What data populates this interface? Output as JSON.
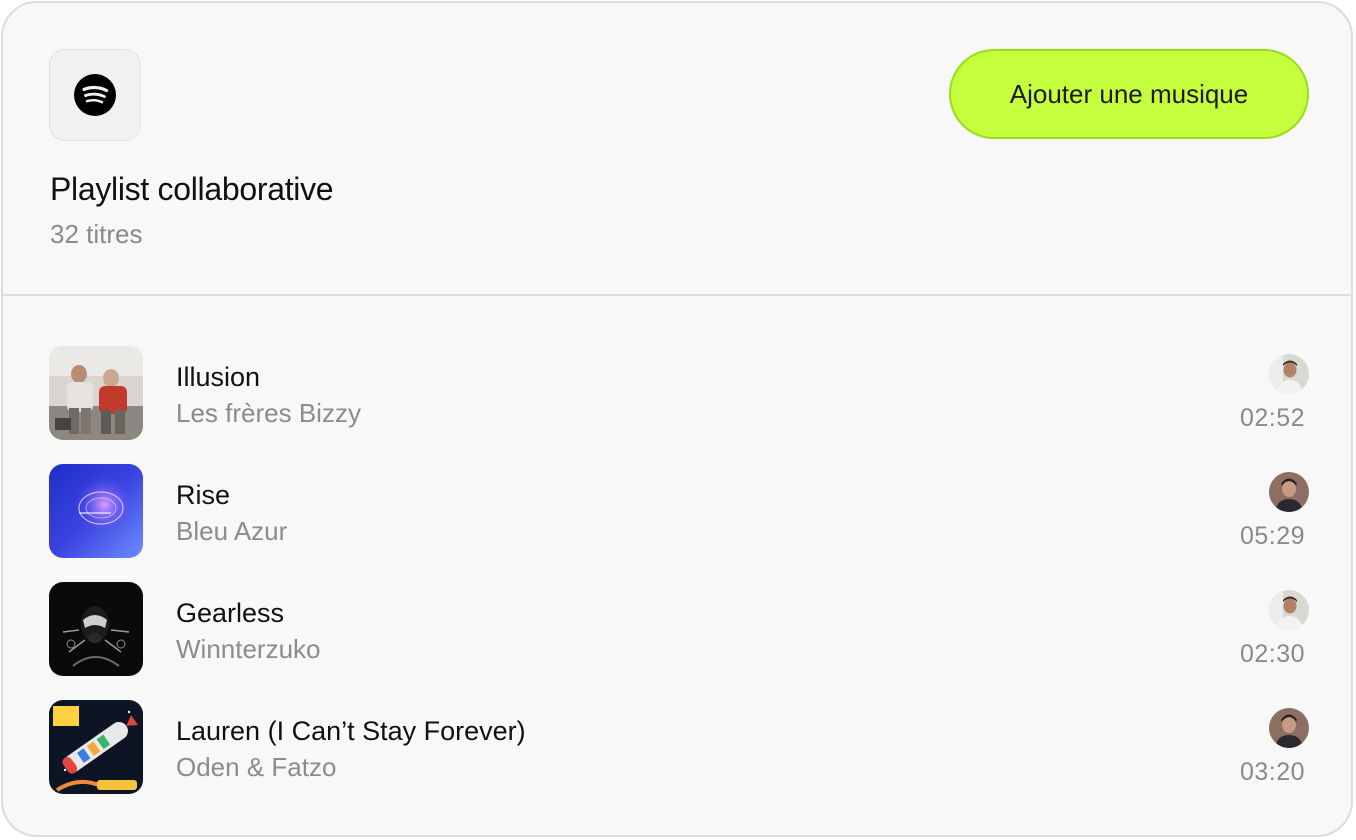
{
  "header": {
    "logo_icon": "spotify-icon",
    "title": "Playlist collaborative",
    "subtitle": "32 titres",
    "add_button_label": "Ajouter une musique",
    "accent_color": "#c5fe3c"
  },
  "tracks": [
    {
      "title": "Illusion",
      "artist": "Les frères Bizzy",
      "duration": "02:52",
      "cover_icon": "album-cover",
      "avatar_icon": "user-avatar"
    },
    {
      "title": "Rise",
      "artist": "Bleu Azur",
      "duration": "05:29",
      "cover_icon": "album-cover",
      "avatar_icon": "user-avatar"
    },
    {
      "title": "Gearless",
      "artist": "Winnterzuko",
      "duration": "02:30",
      "cover_icon": "album-cover",
      "avatar_icon": "user-avatar"
    },
    {
      "title": "Lauren (I Can’t Stay Forever)",
      "artist": "Oden & Fatzo",
      "duration": "03:20",
      "cover_icon": "album-cover",
      "avatar_icon": "user-avatar"
    }
  ]
}
